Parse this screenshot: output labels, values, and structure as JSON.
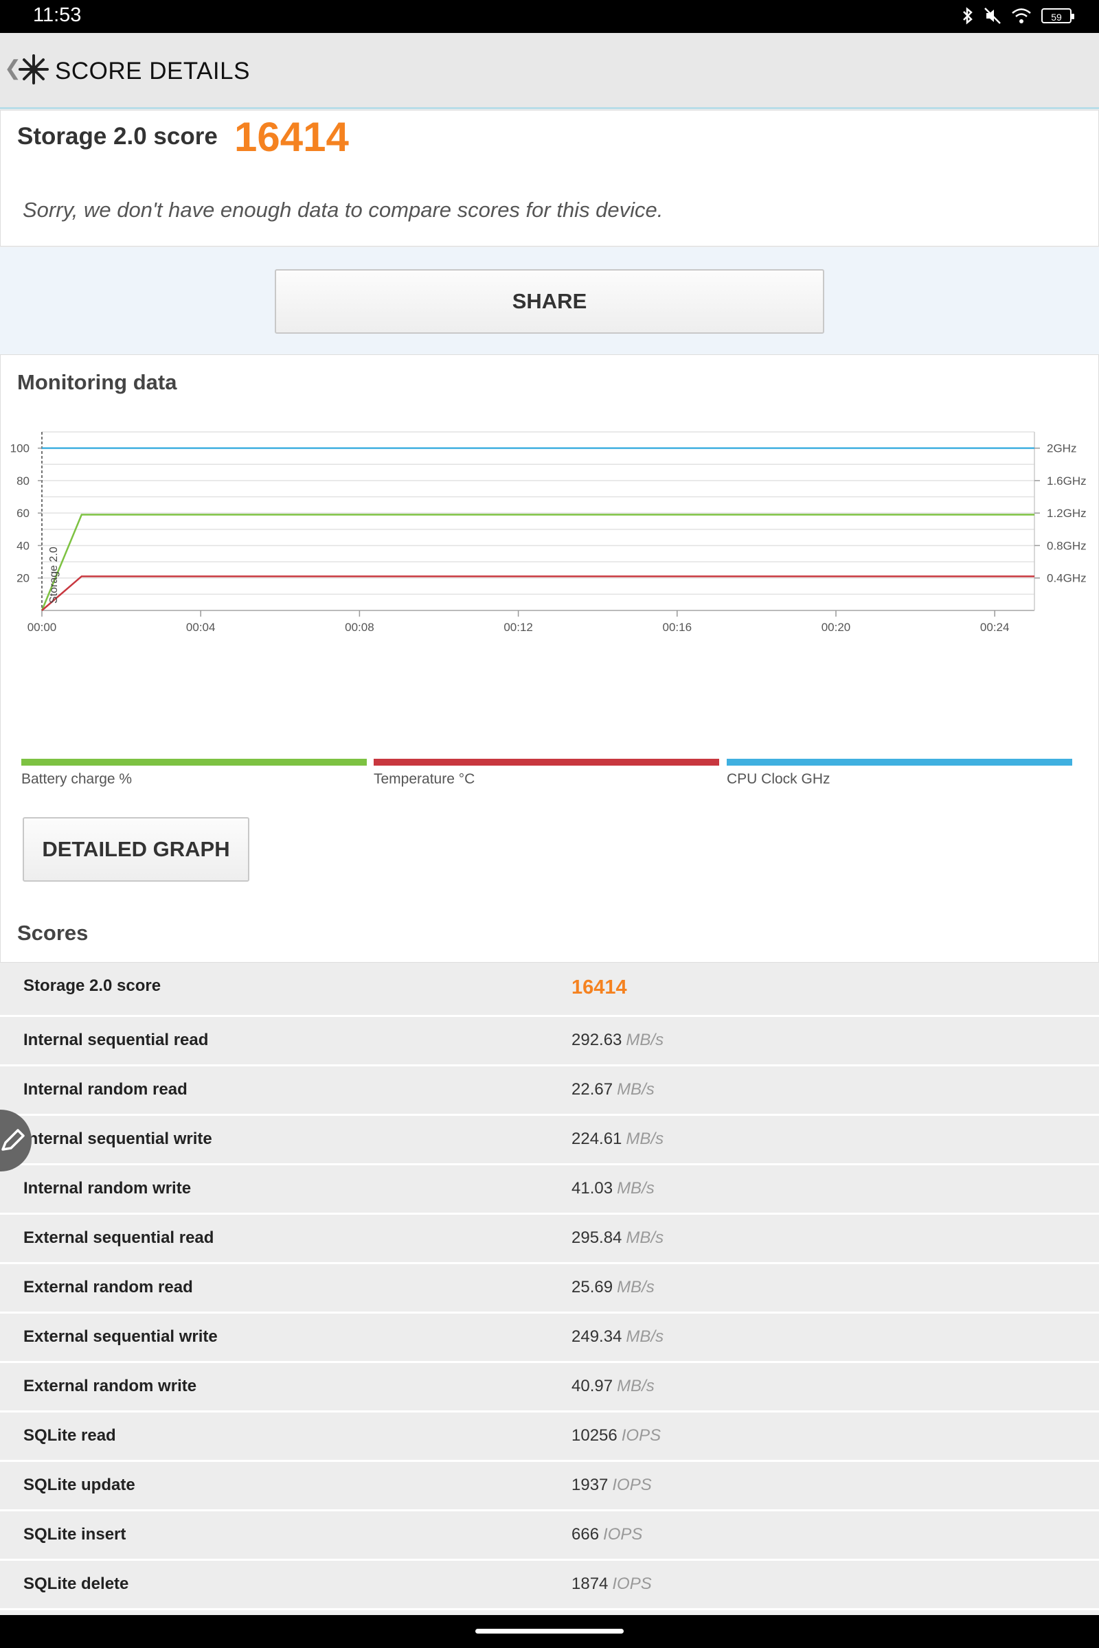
{
  "status": {
    "time": "11:53",
    "battery": "59"
  },
  "header": {
    "title": "SCORE DETAILS"
  },
  "summary": {
    "label": "Storage 2.0 score",
    "value": "16414",
    "compare_message": "Sorry, we don't have enough data to compare scores for this device."
  },
  "share_label": "SHARE",
  "monitoring": {
    "heading": "Monitoring data",
    "detailed_graph_label": "DETAILED GRAPH",
    "scores_heading": "Scores"
  },
  "colors": {
    "accent": "#f58220",
    "battery": "#7dc242",
    "temperature": "#c8373f",
    "cpu": "#40b0e0"
  },
  "chart_data": {
    "type": "line",
    "x_ticks": [
      "00:00",
      "00:04",
      "00:08",
      "00:12",
      "00:16",
      "00:20",
      "00:24"
    ],
    "y_left_ticks": [
      "20",
      "40",
      "60",
      "80",
      "100"
    ],
    "y_right_ticks": [
      "0.4GHz",
      "0.8GHz",
      "1.2GHz",
      "1.6GHz",
      "2GHz"
    ],
    "ylim": [
      0,
      110
    ],
    "xlim": [
      0,
      25
    ],
    "marker_label": "Storage 2.0",
    "series": [
      {
        "name": "Battery charge %",
        "color": "#7dc242",
        "x": [
          0,
          1,
          25
        ],
        "y": [
          0,
          59,
          59
        ]
      },
      {
        "name": "Temperature °C",
        "color": "#c8373f",
        "x": [
          0,
          1,
          25
        ],
        "y": [
          0,
          21,
          21
        ]
      },
      {
        "name": "CPU Clock GHz",
        "color": "#40b0e0",
        "x": [
          0,
          25
        ],
        "y": [
          100,
          100
        ]
      }
    ]
  },
  "scores": [
    {
      "name": "Storage 2.0 score",
      "value": "16414",
      "unit": ""
    },
    {
      "name": "Internal sequential read",
      "value": "292.63",
      "unit": "MB/s"
    },
    {
      "name": "Internal random read",
      "value": "22.67",
      "unit": "MB/s"
    },
    {
      "name": "Internal sequential write",
      "value": "224.61",
      "unit": "MB/s"
    },
    {
      "name": "Internal random write",
      "value": "41.03",
      "unit": "MB/s"
    },
    {
      "name": "External sequential read",
      "value": "295.84",
      "unit": "MB/s"
    },
    {
      "name": "External random read",
      "value": "25.69",
      "unit": "MB/s"
    },
    {
      "name": "External sequential write",
      "value": "249.34",
      "unit": "MB/s"
    },
    {
      "name": "External random write",
      "value": "40.97",
      "unit": "MB/s"
    },
    {
      "name": "SQLite read",
      "value": "10256",
      "unit": "IOPS"
    },
    {
      "name": "SQLite update",
      "value": "1937",
      "unit": "IOPS"
    },
    {
      "name": "SQLite insert",
      "value": "666",
      "unit": "IOPS"
    },
    {
      "name": "SQLite delete",
      "value": "1874",
      "unit": "IOPS"
    }
  ]
}
